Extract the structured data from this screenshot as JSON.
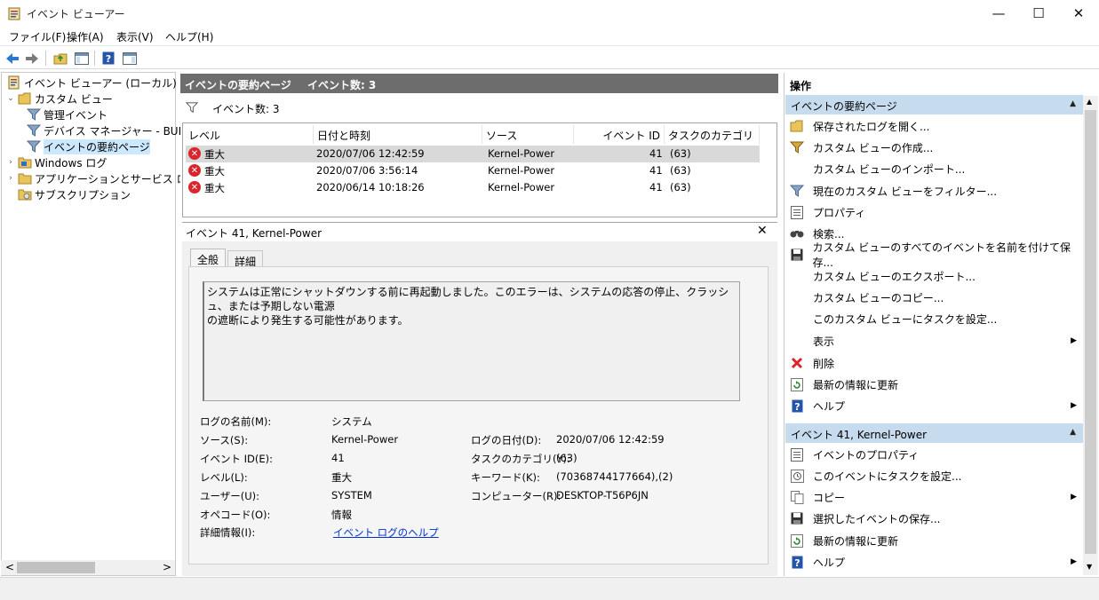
{
  "window": {
    "title": "イベント ビューアー",
    "minimize": "—",
    "maximize": "☐",
    "close": "✕"
  },
  "menu": [
    "ファイル(F)",
    "操作(A)",
    "表示(V)",
    "ヘルプ(H)"
  ],
  "tree": {
    "root": "イベント ビューアー (ローカル)",
    "custom_views": "カスタム ビュー",
    "admin_events": "管理イベント",
    "device_manager": "デバイス マネージャー - BUFF",
    "summary_page": "イベントの要約ページ",
    "windows_logs": "Windows ログ",
    "app_service_logs": "アプリケーションとサービス ログ",
    "subscriptions": "サブスクリプション",
    "scroll_left": "<",
    "scroll_right": ">"
  },
  "center": {
    "header_title": "イベントの要約ページ",
    "header_count": "イベント数: 3",
    "filter_count": "イベント数: 3",
    "columns": [
      "レベル",
      "日付と時刻",
      "ソース",
      "イベント ID",
      "タスクのカテゴリ"
    ],
    "rows": [
      {
        "level": "重大",
        "datetime": "2020/07/06 12:42:59",
        "source": "Kernel-Power",
        "event_id": "41",
        "category": "(63)"
      },
      {
        "level": "重大",
        "datetime": "2020/07/06 3:56:14",
        "source": "Kernel-Power",
        "event_id": "41",
        "category": "(63)"
      },
      {
        "level": "重大",
        "datetime": "2020/06/14 10:18:26",
        "source": "Kernel-Power",
        "event_id": "41",
        "category": "(63)"
      }
    ]
  },
  "detail": {
    "title": "イベント 41, Kernel-Power",
    "close": "✕",
    "tab_general": "全般",
    "tab_details": "詳細",
    "description_line1": "システムは正常にシャットダウンする前に再起動しました。このエラーは、システムの応答の停止、クラッシュ、または予期しない電源",
    "description_line2": "の遮断により発生する可能性があります。",
    "fields": {
      "log_name_label": "ログの名前(M):",
      "log_name": "システム",
      "source_label": "ソース(S):",
      "source": "Kernel-Power",
      "logged_label": "ログの日付(D):",
      "logged": "2020/07/06 12:42:59",
      "event_id_label": "イベント ID(E):",
      "event_id": "41",
      "task_label": "タスクのカテゴリ(Y):",
      "task": "(63)",
      "level_label": "レベル(L):",
      "level": "重大",
      "keywords_label": "キーワード(K):",
      "keywords": "(70368744177664),(2)",
      "user_label": "ユーザー(U):",
      "user": "SYSTEM",
      "computer_label": "コンピューター(R):",
      "computer": "DESKTOP-T56P6JN",
      "opcode_label": "オペコード(O):",
      "opcode": "情報",
      "more_info_label": "詳細情報(I):",
      "more_info_link": "イベント ログのヘルプ"
    }
  },
  "actions": {
    "header": "操作",
    "section1": "イベントの要約ページ",
    "items1": [
      "保存されたログを開く...",
      "カスタム ビューの作成...",
      "カスタム ビューのインポート...",
      "現在のカスタム ビューをフィルター...",
      "プロパティ",
      "検索...",
      "カスタム ビューのすべてのイベントを名前を付けて保存...",
      "カスタム ビューのエクスポート...",
      "カスタム ビューのコピー...",
      "このカスタム ビューにタスクを設定...",
      "表示",
      "削除",
      "最新の情報に更新",
      "ヘルプ"
    ],
    "section2": "イベント 41, Kernel-Power",
    "items2": [
      "イベントのプロパティ",
      "このイベントにタスクを設定...",
      "コピー",
      "選択したイベントの保存...",
      "最新の情報に更新",
      "ヘルプ"
    ]
  },
  "colors": {
    "accent_header": "#6d6d6d",
    "section_header": "#c6dbee",
    "error_red": "#d9252b",
    "link_blue": "#0033cc"
  }
}
